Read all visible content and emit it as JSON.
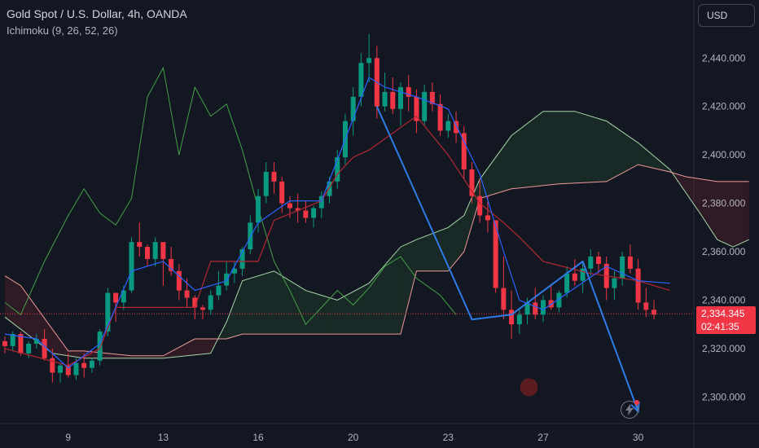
{
  "header": {
    "title": "Gold Spot / U.S. Dollar, 4h, OANDA",
    "indicator": "Ichimoku (9, 26, 52, 26)",
    "currency_button": "USD"
  },
  "price_tag": {
    "price": "2,334.345",
    "countdown": "02:41:35",
    "color": "#f23645"
  },
  "icons": {
    "alert": "lightning-icon"
  },
  "colors": {
    "background": "#131722",
    "up_candle": "#089981",
    "down_candle": "#f23645",
    "tenkan": "#2962ff",
    "kijun": "#b22833",
    "lagging_span": "#43a047",
    "senkou_a": "#a5d6a7",
    "senkou_b": "#ef9a9a",
    "drawing": "#2e7be8"
  },
  "chart_data": {
    "type": "candlestick",
    "title": "Gold Spot / U.S. Dollar, 4h, OANDA",
    "y_ticks": [
      "2,440.000",
      "2,420.000",
      "2,400.000",
      "2,380.000",
      "2,360.000",
      "2,340.000",
      "2,320.000",
      "2,300.000"
    ],
    "y_tick_values": [
      2440,
      2420,
      2400,
      2380,
      2360,
      2340,
      2320,
      2300
    ],
    "ylim": [
      2289,
      2464
    ],
    "x_ticks": [
      "9",
      "13",
      "16",
      "20",
      "23",
      "27",
      "30"
    ],
    "x_tick_positions": [
      8,
      20,
      32,
      44,
      56,
      68,
      80
    ],
    "current_price": 2334.345,
    "candles": [
      [
        2323,
        2325,
        2318,
        2321
      ],
      [
        2321,
        2327,
        2319,
        2326
      ],
      [
        2326,
        2327,
        2317,
        2318
      ],
      [
        2318,
        2323,
        2316,
        2322
      ],
      [
        2322,
        2326,
        2320,
        2324
      ],
      [
        2324,
        2328,
        2315,
        2316
      ],
      [
        2316,
        2320,
        2306,
        2310
      ],
      [
        2310,
        2314,
        2306,
        2313
      ],
      [
        2313,
        2318,
        2308,
        2309
      ],
      [
        2309,
        2316,
        2307,
        2314
      ],
      [
        2314,
        2318,
        2308,
        2312
      ],
      [
        2312,
        2316,
        2310,
        2315
      ],
      [
        2315,
        2328,
        2313,
        2327
      ],
      [
        2327,
        2345,
        2325,
        2343
      ],
      [
        2343,
        2342,
        2331,
        2339
      ],
      [
        2339,
        2346,
        2336,
        2344
      ],
      [
        2344,
        2366,
        2343,
        2364
      ],
      [
        2364,
        2372,
        2358,
        2362
      ],
      [
        2362,
        2363,
        2354,
        2357
      ],
      [
        2357,
        2366,
        2354,
        2364
      ],
      [
        2364,
        2363,
        2346,
        2357
      ],
      [
        2357,
        2362,
        2350,
        2352
      ],
      [
        2352,
        2355,
        2340,
        2344
      ],
      [
        2344,
        2349,
        2337,
        2341
      ],
      [
        2341,
        2342,
        2332,
        2337
      ],
      [
        2337,
        2338,
        2332,
        2336
      ],
      [
        2336,
        2344,
        2334,
        2342
      ],
      [
        2342,
        2352,
        2340,
        2346
      ],
      [
        2346,
        2356,
        2344,
        2351
      ],
      [
        2351,
        2356,
        2347,
        2353
      ],
      [
        2353,
        2362,
        2350,
        2361
      ],
      [
        2361,
        2375,
        2359,
        2372
      ],
      [
        2372,
        2386,
        2368,
        2383
      ],
      [
        2383,
        2397,
        2380,
        2393
      ],
      [
        2393,
        2397,
        2384,
        2389
      ],
      [
        2389,
        2391,
        2376,
        2380
      ],
      [
        2380,
        2383,
        2374,
        2378
      ],
      [
        2378,
        2384,
        2372,
        2377
      ],
      [
        2377,
        2381,
        2372,
        2374
      ],
      [
        2374,
        2379,
        2370,
        2378
      ],
      [
        2378,
        2385,
        2374,
        2383
      ],
      [
        2383,
        2391,
        2380,
        2389
      ],
      [
        2389,
        2402,
        2386,
        2399
      ],
      [
        2399,
        2417,
        2396,
        2414
      ],
      [
        2414,
        2428,
        2408,
        2424
      ],
      [
        2424,
        2442,
        2420,
        2438
      ],
      [
        2438,
        2450,
        2430,
        2440
      ],
      [
        2440,
        2445,
        2415,
        2420
      ],
      [
        2420,
        2434,
        2418,
        2426
      ],
      [
        2426,
        2432,
        2417,
        2419
      ],
      [
        2419,
        2430,
        2412,
        2428
      ],
      [
        2428,
        2433,
        2418,
        2424
      ],
      [
        2424,
        2427,
        2409,
        2414
      ],
      [
        2414,
        2429,
        2412,
        2426
      ],
      [
        2426,
        2430,
        2418,
        2421
      ],
      [
        2421,
        2425,
        2408,
        2410
      ],
      [
        2410,
        2417,
        2407,
        2414
      ],
      [
        2414,
        2418,
        2405,
        2409
      ],
      [
        2409,
        2412,
        2390,
        2394
      ],
      [
        2394,
        2397,
        2380,
        2383
      ],
      [
        2383,
        2390,
        2372,
        2375
      ],
      [
        2375,
        2383,
        2368,
        2373
      ],
      [
        2373,
        2366,
        2343,
        2345
      ],
      [
        2345,
        2358,
        2332,
        2336
      ],
      [
        2336,
        2344,
        2324,
        2330
      ],
      [
        2330,
        2336,
        2326,
        2334
      ],
      [
        2334,
        2341,
        2330,
        2339
      ],
      [
        2339,
        2345,
        2332,
        2334
      ],
      [
        2334,
        2342,
        2331,
        2340
      ],
      [
        2340,
        2346,
        2336,
        2337
      ],
      [
        2337,
        2344,
        2335,
        2343
      ],
      [
        2343,
        2354,
        2341,
        2351
      ],
      [
        2351,
        2357,
        2346,
        2348
      ],
      [
        2348,
        2355,
        2343,
        2353
      ],
      [
        2353,
        2361,
        2350,
        2358
      ],
      [
        2358,
        2360,
        2351,
        2355
      ],
      [
        2355,
        2358,
        2340,
        2345
      ],
      [
        2345,
        2352,
        2340,
        2349
      ],
      [
        2349,
        2360,
        2346,
        2358
      ],
      [
        2358,
        2363,
        2351,
        2353
      ],
      [
        2353,
        2357,
        2336,
        2339
      ],
      [
        2339,
        2345,
        2333,
        2336
      ],
      [
        2336,
        2340,
        2332,
        2334
      ]
    ],
    "tenkan_sen": [
      [
        0,
        2326
      ],
      [
        4,
        2324
      ],
      [
        8,
        2312
      ],
      [
        12,
        2322
      ],
      [
        16,
        2352
      ],
      [
        20,
        2356
      ],
      [
        24,
        2344
      ],
      [
        28,
        2348
      ],
      [
        32,
        2372
      ],
      [
        36,
        2381
      ],
      [
        40,
        2381
      ],
      [
        44,
        2415
      ],
      [
        46,
        2432
      ],
      [
        48,
        2428
      ],
      [
        52,
        2424
      ],
      [
        56,
        2419
      ],
      [
        60,
        2392
      ],
      [
        63,
        2360
      ],
      [
        65,
        2340
      ],
      [
        68,
        2336
      ],
      [
        72,
        2345
      ],
      [
        76,
        2354
      ],
      [
        80,
        2348
      ],
      [
        84,
        2347
      ]
    ],
    "kijun_sen": [
      [
        0,
        2320
      ],
      [
        8,
        2313
      ],
      [
        12,
        2320
      ],
      [
        14,
        2337
      ],
      [
        24,
        2337
      ],
      [
        26,
        2356
      ],
      [
        32,
        2356
      ],
      [
        34,
        2373
      ],
      [
        40,
        2381
      ],
      [
        42,
        2392
      ],
      [
        44,
        2399
      ],
      [
        46,
        2402
      ],
      [
        52,
        2416
      ],
      [
        56,
        2400
      ],
      [
        60,
        2380
      ],
      [
        63,
        2372
      ],
      [
        65,
        2366
      ],
      [
        68,
        2356
      ],
      [
        74,
        2351
      ],
      [
        78,
        2349
      ],
      [
        80,
        2348
      ],
      [
        84,
        2344
      ]
    ],
    "chikou_span": [
      [
        0,
        2339
      ],
      [
        2,
        2334
      ],
      [
        5,
        2356
      ],
      [
        8,
        2375
      ],
      [
        10,
        2386
      ],
      [
        12,
        2376
      ],
      [
        14,
        2371
      ],
      [
        16,
        2382
      ],
      [
        18,
        2424
      ],
      [
        20,
        2436
      ],
      [
        22,
        2400
      ],
      [
        24,
        2428
      ],
      [
        26,
        2416
      ],
      [
        28,
        2421
      ],
      [
        30,
        2402
      ],
      [
        32,
        2378
      ],
      [
        34,
        2356
      ],
      [
        36,
        2344
      ],
      [
        38,
        2330
      ],
      [
        40,
        2337
      ],
      [
        42,
        2344
      ],
      [
        44,
        2338
      ],
      [
        46,
        2345
      ],
      [
        48,
        2354
      ],
      [
        50,
        2358
      ],
      [
        52,
        2349
      ],
      [
        55,
        2342
      ],
      [
        57,
        2334
      ]
    ],
    "senkou_span_a": [
      [
        0,
        2333
      ],
      [
        6,
        2318
      ],
      [
        10,
        2316
      ],
      [
        16,
        2316
      ],
      [
        20,
        2316
      ],
      [
        26,
        2318
      ],
      [
        28,
        2331
      ],
      [
        30,
        2348
      ],
      [
        34,
        2352
      ],
      [
        38,
        2344
      ],
      [
        42,
        2340
      ],
      [
        46,
        2347
      ],
      [
        50,
        2362
      ],
      [
        52,
        2365
      ],
      [
        56,
        2370
      ],
      [
        58,
        2375
      ],
      [
        60,
        2390
      ],
      [
        64,
        2408
      ],
      [
        68,
        2418
      ],
      [
        72,
        2418
      ],
      [
        76,
        2414
      ],
      [
        80,
        2405
      ],
      [
        84,
        2394
      ],
      [
        88,
        2375
      ],
      [
        90,
        2365
      ],
      [
        92,
        2362
      ],
      [
        94,
        2365
      ]
    ],
    "senkou_span_b": [
      [
        0,
        2350
      ],
      [
        2,
        2346
      ],
      [
        8,
        2319
      ],
      [
        10,
        2319
      ],
      [
        16,
        2317
      ],
      [
        20,
        2317
      ],
      [
        24,
        2324
      ],
      [
        28,
        2324
      ],
      [
        30,
        2326
      ],
      [
        40,
        2326
      ],
      [
        46,
        2326
      ],
      [
        50,
        2326
      ],
      [
        52,
        2352
      ],
      [
        56,
        2352
      ],
      [
        58,
        2360
      ],
      [
        60,
        2382
      ],
      [
        64,
        2386
      ],
      [
        70,
        2388
      ],
      [
        76,
        2389
      ],
      [
        80,
        2396
      ],
      [
        84,
        2393
      ],
      [
        86,
        2391
      ],
      [
        90,
        2389
      ],
      [
        94,
        2389
      ]
    ],
    "drawings": [
      {
        "type": "polyline",
        "points": [
          [
            47,
            2420
          ],
          [
            59,
            2332
          ],
          [
            64,
            2334
          ],
          [
            73,
            2356
          ],
          [
            80,
            2294
          ]
        ]
      }
    ]
  }
}
